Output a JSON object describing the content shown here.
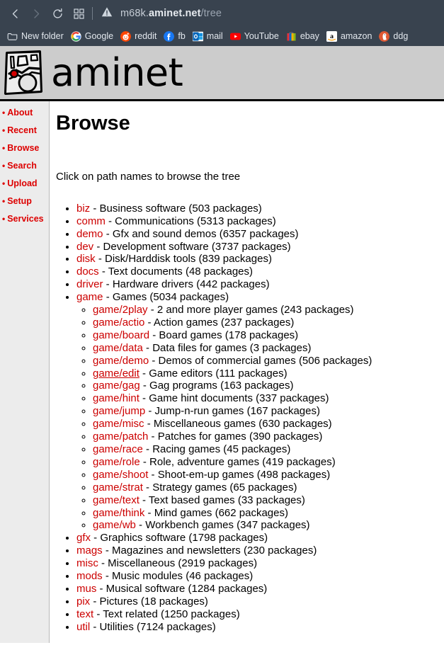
{
  "browser": {
    "toolbar": {
      "back_icon": "back-arrow-icon",
      "forward_icon": "forward-arrow-icon",
      "reload_icon": "reload-icon",
      "apps_icon": "grid-apps-icon",
      "security_icon": "not-secure-warning-icon",
      "url_prefix": "m68k.",
      "url_host": "aminet.net",
      "url_path": "/tree"
    },
    "bookmarks": [
      {
        "label": "New folder",
        "icon": "folder-icon"
      },
      {
        "label": "Google",
        "icon": "google-icon"
      },
      {
        "label": "reddit",
        "icon": "reddit-icon"
      },
      {
        "label": "fb",
        "icon": "facebook-icon"
      },
      {
        "label": "mail",
        "icon": "outlook-mail-icon"
      },
      {
        "label": "YouTube",
        "icon": "youtube-icon"
      },
      {
        "label": "ebay",
        "icon": "ebay-icon"
      },
      {
        "label": "amazon",
        "icon": "amazon-icon"
      },
      {
        "label": "ddg",
        "icon": "duckduckgo-icon"
      }
    ]
  },
  "site": {
    "logo_text": "aminet",
    "logo_icon": "aminet-map-logo-icon",
    "header_bg": "#cccccc"
  },
  "sidebar": {
    "items": [
      {
        "label": "About"
      },
      {
        "label": "Recent"
      },
      {
        "label": "Browse"
      },
      {
        "label": "Search"
      },
      {
        "label": "Upload"
      },
      {
        "label": "Setup"
      },
      {
        "label": "Services"
      }
    ],
    "link_color": "#dd0000"
  },
  "main": {
    "title": "Browse",
    "intro": "Click on path names to browse the tree",
    "link_color": "#cc0000",
    "tree": [
      {
        "name": "biz",
        "desc": " - Business software (503 packages)"
      },
      {
        "name": "comm",
        "desc": " - Communications (5313 packages)"
      },
      {
        "name": "demo",
        "desc": " - Gfx and sound demos (6357 packages)"
      },
      {
        "name": "dev",
        "desc": " - Development software (3737 packages)"
      },
      {
        "name": "disk",
        "desc": " - Disk/Harddisk tools (839 packages)"
      },
      {
        "name": "docs",
        "desc": " - Text documents (48 packages)"
      },
      {
        "name": "driver",
        "desc": " - Hardware drivers (442 packages)"
      },
      {
        "name": "game",
        "desc": " - Games (5034 packages)",
        "children": [
          {
            "name": "game/2play",
            "desc": " - 2 and more player games (243 packages)"
          },
          {
            "name": "game/actio",
            "desc": " - Action games (237 packages)"
          },
          {
            "name": "game/board",
            "desc": " - Board games (178 packages)"
          },
          {
            "name": "game/data",
            "desc": " - Data files for games (3 packages)"
          },
          {
            "name": "game/demo",
            "desc": " - Demos of commercial games (506 packages)"
          },
          {
            "name": "game/edit",
            "desc": " - Game editors (111 packages)",
            "hover": true
          },
          {
            "name": "game/gag",
            "desc": " - Gag programs (163 packages)"
          },
          {
            "name": "game/hint",
            "desc": " - Game hint documents (337 packages)"
          },
          {
            "name": "game/jump",
            "desc": " - Jump-n-run games (167 packages)"
          },
          {
            "name": "game/misc",
            "desc": " - Miscellaneous games (630 packages)"
          },
          {
            "name": "game/patch",
            "desc": " - Patches for games (390 packages)"
          },
          {
            "name": "game/race",
            "desc": " - Racing games (45 packages)"
          },
          {
            "name": "game/role",
            "desc": " - Role, adventure games (419 packages)"
          },
          {
            "name": "game/shoot",
            "desc": " - Shoot-em-up games (498 packages)"
          },
          {
            "name": "game/strat",
            "desc": " - Strategy games (65 packages)"
          },
          {
            "name": "game/text",
            "desc": " - Text based games (33 packages)"
          },
          {
            "name": "game/think",
            "desc": " - Mind games (662 packages)"
          },
          {
            "name": "game/wb",
            "desc": " - Workbench games (347 packages)"
          }
        ]
      },
      {
        "name": "gfx",
        "desc": " - Graphics software (1798 packages)"
      },
      {
        "name": "mags",
        "desc": " - Magazines and newsletters (230 packages)"
      },
      {
        "name": "misc",
        "desc": " - Miscellaneous (2919 packages)"
      },
      {
        "name": "mods",
        "desc": " - Music modules (46 packages)"
      },
      {
        "name": "mus",
        "desc": " - Musical software (1284 packages)"
      },
      {
        "name": "pix",
        "desc": " - Pictures (18 packages)"
      },
      {
        "name": "text",
        "desc": " - Text related (1250 packages)"
      },
      {
        "name": "util",
        "desc": " - Utilities (7124 packages)"
      }
    ]
  }
}
